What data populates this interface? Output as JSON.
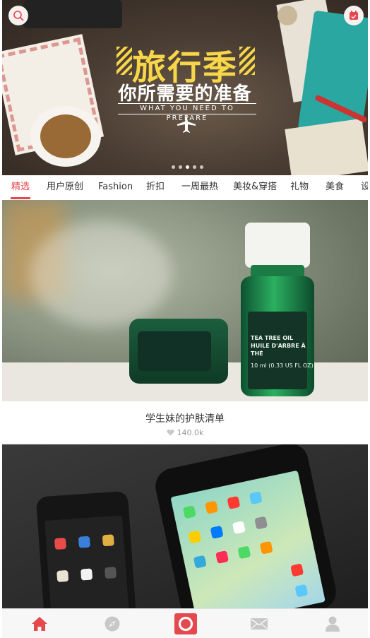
{
  "banner": {
    "title": "旅行季",
    "subtitle": "你所需要的准备",
    "english": "WHAT YOU NEED TO PREPARE",
    "dot_count": 5,
    "active_dot": 3
  },
  "tabs": [
    {
      "label": "精选",
      "active": true
    },
    {
      "label": "用户原创",
      "active": false
    },
    {
      "label": "Fashion",
      "active": false
    },
    {
      "label": "折扣",
      "active": false
    },
    {
      "label": "一周最热",
      "active": false
    },
    {
      "label": "美妆&穿搭",
      "active": false
    },
    {
      "label": "礼物",
      "active": false
    },
    {
      "label": "美食",
      "active": false
    },
    {
      "label": "设",
      "active": false
    }
  ],
  "feed": {
    "card1": {
      "title": "学生妹的护肤清单",
      "likes": "140.0k",
      "label_line1": "TEA TREE OIL",
      "label_line2": "HUILE D'ARBRE À THÉ",
      "label_line3": "10 ml (0.33 US FL OZ)"
    }
  },
  "bottom_nav": {
    "items": [
      "home-icon",
      "compass-icon",
      "record-icon",
      "mail-icon",
      "user-icon"
    ],
    "active": "home-icon"
  },
  "colors": {
    "accent": "#e5484d",
    "banner_title": "#f7d64a",
    "nav_inactive": "#c8c8c8"
  }
}
